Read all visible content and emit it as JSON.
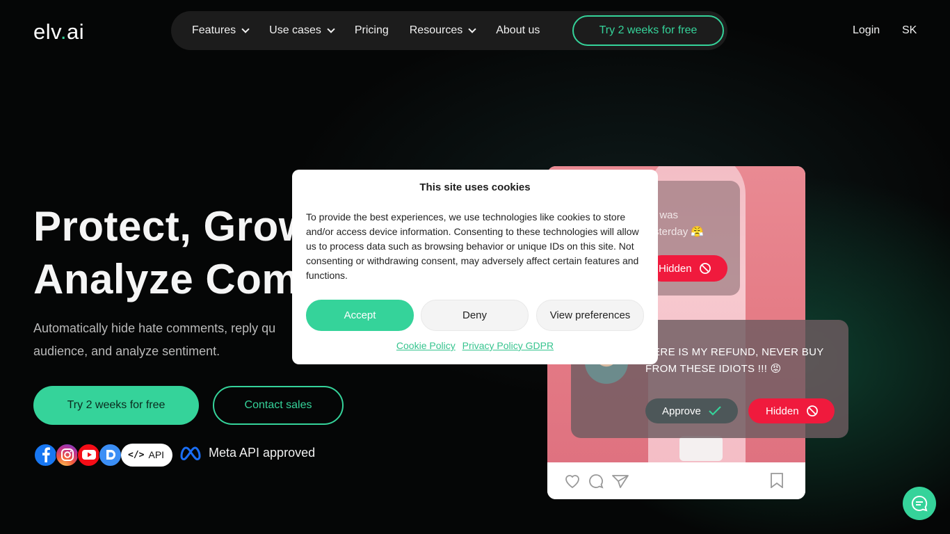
{
  "header": {
    "logo_prefix": "elv",
    "logo_dot": ".",
    "logo_suffix": "ai",
    "nav": [
      {
        "label": "Features",
        "dropdown": true
      },
      {
        "label": "Use cases",
        "dropdown": true
      },
      {
        "label": "Pricing",
        "dropdown": false
      },
      {
        "label": "Resources",
        "dropdown": true
      },
      {
        "label": "About us",
        "dropdown": false
      }
    ],
    "nav_cta": "Try 2 weeks for free",
    "login": "Login",
    "language": "SK"
  },
  "hero": {
    "title_line1": "Protect, Grow",
    "title_line2": "Analyze Com",
    "subtitle_line1": "Automatically hide hate comments, reply qu",
    "subtitle_line2": "audience, and analyze sentiment.",
    "primary_button": "Try 2 weeks for free",
    "secondary_button": "Contact sales",
    "platform_icons": [
      "facebook-icon",
      "instagram-icon",
      "youtube-icon",
      "discord-icon"
    ],
    "api_label": "API",
    "meta_label": "Meta API approved"
  },
  "mock": {
    "comment1_text": "t was\nsterday 😤",
    "comment1_action": "Hidden",
    "comment2_text": "HERE IS MY REFUND, NEVER BUY FROM THESE IDIOTS !!! 😡",
    "approve_label": "Approve",
    "hidden_label": "Hidden"
  },
  "cookie_modal": {
    "title": "This site uses cookies",
    "body": "To provide the best experiences, we use technologies like cookies to store and/or access device information. Consenting to these technologies will allow us to process data such as browsing behavior or unique IDs on this site. Not consenting or withdrawing consent, may adversely affect certain features and functions.",
    "accept": "Accept",
    "deny": "Deny",
    "preferences": "View preferences",
    "cookie_policy": "Cookie Policy",
    "privacy_policy": "Privacy Policy GDPR"
  },
  "colors": {
    "accent": "#35d39a",
    "danger": "#f01a3d",
    "background": "#050606"
  }
}
